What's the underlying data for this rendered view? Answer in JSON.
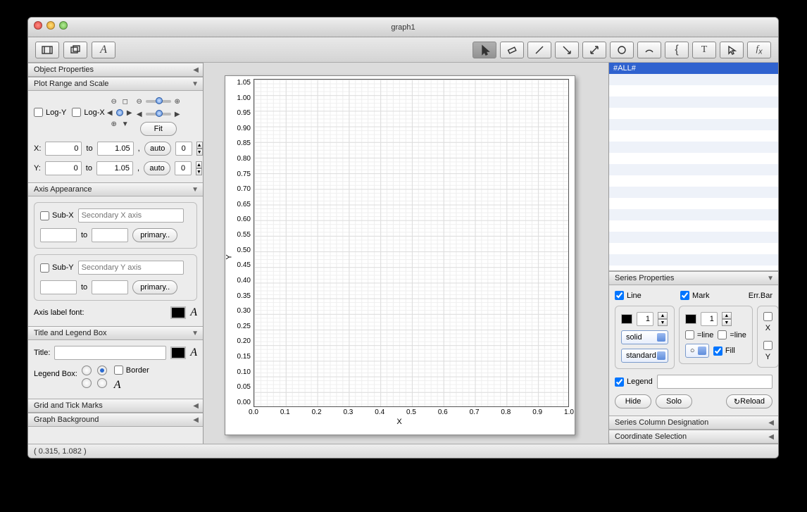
{
  "window_title": "graph1",
  "statusbar_text": "( 0.315,  1.082 )",
  "left": {
    "object_properties": "Object Properties",
    "plot_range": {
      "title": "Plot Range and Scale",
      "logy": "Log-Y",
      "logx": "Log-X",
      "fit": "Fit",
      "x_label": "X:",
      "y_label": "Y:",
      "x_from": "0",
      "x_to": "1.05",
      "y_from": "0",
      "y_to": "1.05",
      "to_word": "to",
      "comma": ",",
      "auto": "auto",
      "x_margin": "0",
      "y_margin": "0"
    },
    "axis_appearance": {
      "title": "Axis Appearance",
      "subx": "Sub-X",
      "subx_ph": "Secondary X axis",
      "suby": "Sub-Y",
      "suby_ph": "Secondary Y axis",
      "to": "to",
      "primary": "primary..",
      "font_label": "Axis label font:"
    },
    "title_legend": {
      "title": "Title and Legend Box",
      "title_label": "Title:",
      "legend_label": "Legend Box:",
      "border": "Border"
    },
    "grid_ticks": "Grid and Tick Marks",
    "graph_bg": "Graph Background"
  },
  "right": {
    "all_label": "#ALL#",
    "series_props": {
      "title": "Series Properties",
      "line": "Line",
      "mark": "Mark",
      "errbar": "Err.Bar",
      "line_width": "1",
      "mark_size": "1",
      "solid": "solid",
      "standard": "standard",
      "eqline1": "=line",
      "eqline2": "=line",
      "fill": "Fill",
      "x": "X",
      "y": "Y",
      "legend": "Legend",
      "hide": "Hide",
      "solo": "Solo",
      "reload": "Reload"
    },
    "series_col": "Series Column Designation",
    "coord_sel": "Coordinate Selection"
  },
  "chart_data": {
    "type": "scatter",
    "title": "",
    "xlabel": "X",
    "ylabel": "Y",
    "xlim": [
      0,
      1.05
    ],
    "ylim": [
      0,
      1.05
    ],
    "xticks": [
      0.0,
      0.1,
      0.2,
      0.3,
      0.4,
      0.5,
      0.6,
      0.7,
      0.8,
      0.9,
      1.0
    ],
    "yticks": [
      0.0,
      0.05,
      0.1,
      0.15,
      0.2,
      0.25,
      0.3,
      0.35,
      0.4,
      0.45,
      0.5,
      0.55,
      0.6,
      0.65,
      0.7,
      0.75,
      0.8,
      0.85,
      0.9,
      0.95,
      1.0,
      1.05
    ],
    "series": []
  }
}
